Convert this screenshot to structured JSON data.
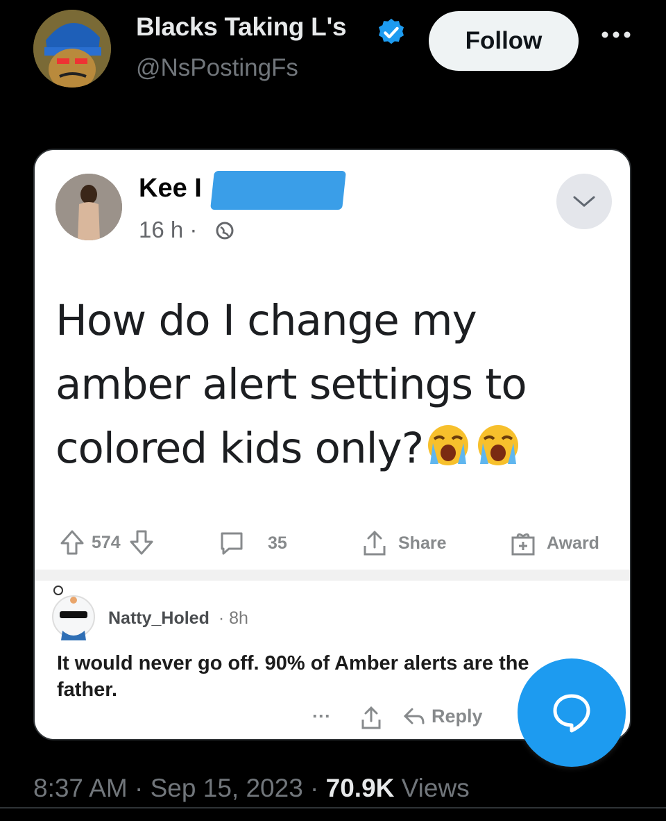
{
  "tweet": {
    "author_name": "Blacks Taking L's",
    "handle": "@NsPostingFs",
    "follow_label": "Follow",
    "verified_color": "#1d9bf0",
    "timestamp": "8:37 AM · Sep 15, 2023 · ",
    "views_count": "70.9K",
    "views_label": " Views"
  },
  "fb_post": {
    "author_name": "Kee I",
    "time": "16 h ·",
    "text_line1": "How do I change my",
    "text_line2": "amber alert settings to",
    "text_line3": "colored kids only?",
    "emoji": "loudly-crying-face"
  },
  "reddit_bar": {
    "upvotes": "574",
    "comments": "35",
    "share_label": "Share",
    "award_label": "Award"
  },
  "comment": {
    "username": "Natty_Holed",
    "age": "· 8h",
    "text": "It would never go off. 90% of Amber alerts are the father.",
    "more": "···",
    "reply_label": "Reply"
  }
}
